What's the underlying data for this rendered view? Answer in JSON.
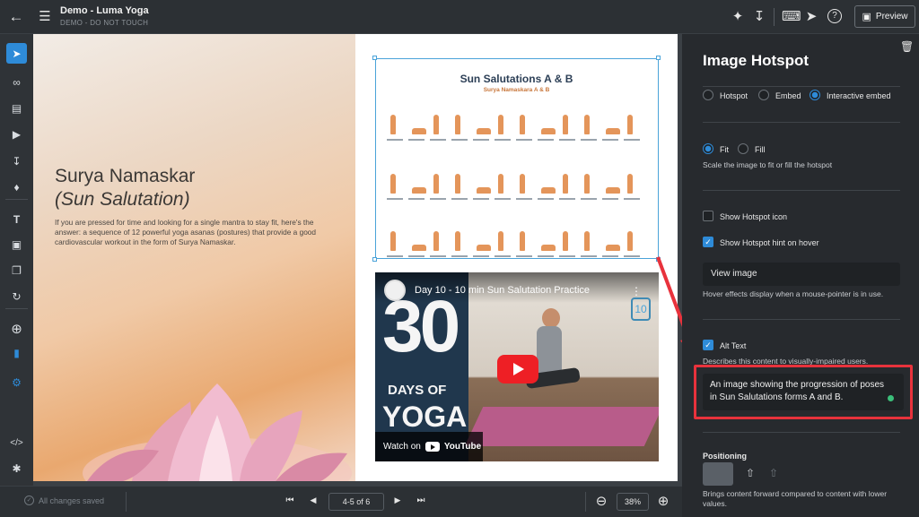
{
  "app": {
    "doc_title": "Demo - Luma Yoga",
    "doc_subtitle": "DEMO - DO NOT TOUCH",
    "preview_label": "Preview"
  },
  "page_left": {
    "heading": "Surya Namaskar",
    "heading_italic": "(Sun Salutation)",
    "body": "If you are pressed for time and looking for a single mantra to stay fit, here's the answer: a sequence of 12 powerful yoga asanas (postures) that provide a good cardiovascular workout in the form of Surya Namaskar."
  },
  "image_hotspot": {
    "title": "Sun Salutations A & B",
    "subtitle": "Surya Namaskara A & B"
  },
  "video": {
    "title": "Day 10 - 10 min Sun Salutation Practice",
    "thumb_big": "30",
    "thumb_days": "DAYS OF",
    "thumb_yoga": "YOGA",
    "badge": "10",
    "watch_on": "Watch on",
    "youtube": "YouTube"
  },
  "bottombar": {
    "save_status": "All changes saved",
    "page_indicator": "4-5 of 6",
    "zoom": "38%"
  },
  "panel": {
    "title": "Image Hotspot",
    "type_options": [
      "Hotspot",
      "Embed",
      "Interactive embed"
    ],
    "type_selected": "Interactive embed",
    "scale_options": [
      "Fit",
      "Fill"
    ],
    "scale_selected": "Fit",
    "scale_help": "Scale the image to fit or fill the hotspot",
    "show_icon_label": "Show Hotspot icon",
    "show_icon_checked": false,
    "show_hint_label": "Show Hotspot hint on hover",
    "show_hint_checked": true,
    "hover_value": "View image",
    "hover_help": "Hover effects display when a mouse-pointer is in use.",
    "alt_label": "Alt Text",
    "alt_checked": true,
    "alt_help": "Describes this content to visually-impaired users.",
    "alt_value": "An image showing the progression of poses in Sun Salutations forms A and B.",
    "positioning_label": "Positioning",
    "positioning_help": "Brings content forward compared to content with lower values."
  },
  "colors": {
    "accent": "#2e8bd8",
    "highlight": "#e8323c",
    "panel_bg": "#272a2e"
  }
}
